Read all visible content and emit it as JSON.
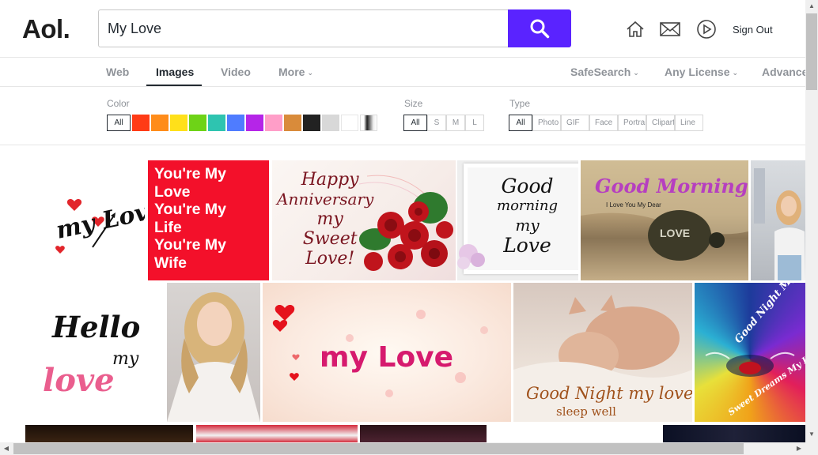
{
  "header": {
    "logo": "Aol.",
    "search_value": "My Love",
    "sign_out": "Sign Out",
    "icons": [
      "home-icon",
      "mail-icon",
      "play-icon",
      "search-icon"
    ]
  },
  "nav": {
    "tabs": [
      {
        "label": "Web"
      },
      {
        "label": "Images"
      },
      {
        "label": "Video"
      },
      {
        "label": "More"
      },
      {
        "label": "SafeSearch"
      },
      {
        "label": "Any License"
      },
      {
        "label": "Advanced"
      }
    ],
    "active_tab": "Images"
  },
  "filters": {
    "color_label": "Color",
    "color_all": "All",
    "colors": [
      "#ff3b16",
      "#ff8c1a",
      "#ffe01a",
      "#6ed317",
      "#2ec4b0",
      "#4f7cff",
      "#b525e8",
      "#ff9ec8",
      "#d98b3a",
      "#222222",
      "#d8d8d8",
      "#ffffff"
    ],
    "size_label": "Size",
    "sizes": [
      "All",
      "S",
      "M",
      "L"
    ],
    "type_label": "Type",
    "types": [
      "All",
      "Photo",
      "GIF",
      "Face",
      "Portrait",
      "Clipart",
      "Line"
    ]
  },
  "images": {
    "r1_love": "my Love",
    "r1_wife": [
      "You're My",
      "Love",
      "You're My",
      "Life",
      "You're My",
      "Wife"
    ],
    "r1_anniv": [
      "Happy",
      "Anniversary",
      "my",
      "Sweet",
      "Love!"
    ],
    "r1_gm": [
      "Good",
      "morning",
      "my",
      "Love"
    ],
    "r1_beach_title": "Good Morning",
    "r1_beach_sub": "I Love You My Dear",
    "r1_beach_stone": "LOVE",
    "r2_hello": [
      "Hello",
      "my",
      "love"
    ],
    "r2_mylove": "my Love",
    "r2_cat_line1": "Good Night my love",
    "r2_cat_line2": "sleep well",
    "r2_gn_line1": "Good Night My Love",
    "r2_gn_line2": "Sweet Dreams My Love"
  },
  "colors": {
    "brand_purple": "#5a23ff",
    "wife_bg": "#f3102a"
  }
}
